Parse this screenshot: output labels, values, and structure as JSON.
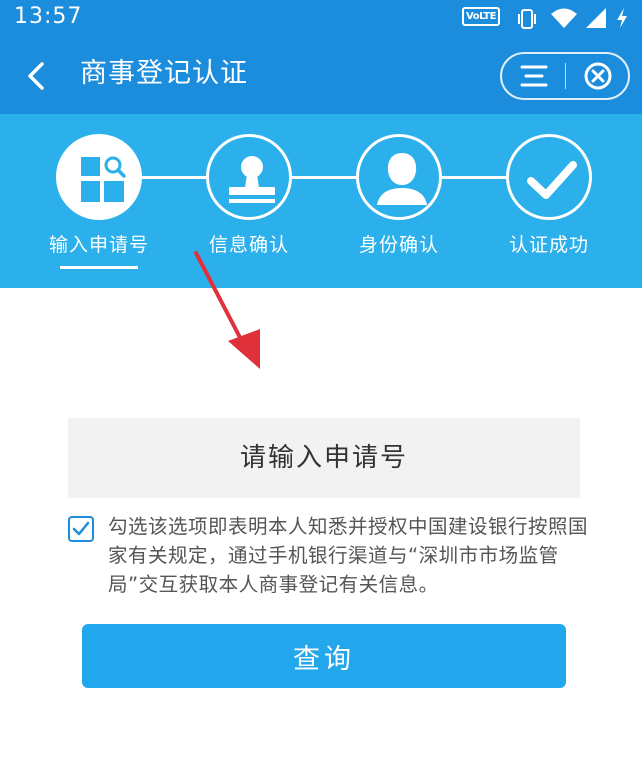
{
  "status_bar": {
    "time": "13:57",
    "network_badge": "VoLTE",
    "icons": [
      "vibrate-icon",
      "wifi-icon",
      "signal-icon",
      "charging-icon"
    ]
  },
  "nav": {
    "back_icon": "chevron-left-icon",
    "title": "商事登记认证",
    "capsule_icons": [
      "menu-icon",
      "close-circle-icon"
    ]
  },
  "steps": [
    {
      "label": "输入申请号",
      "icon": "search-grid-icon",
      "active": true
    },
    {
      "label": "信息确认",
      "icon": "stamp-icon",
      "active": false
    },
    {
      "label": "身份确认",
      "icon": "person-icon",
      "active": false
    },
    {
      "label": "认证成功",
      "icon": "checkmark-icon",
      "active": false
    }
  ],
  "form": {
    "application_no_placeholder": "请输入申请号",
    "agree_checked": true,
    "agree_text": "勾选该选项即表明本人知悉并授权中国建设银行按照国家有关规定，通过手机银行渠道与“深圳市市场监管局”交互获取本人商事登记有关信息。",
    "submit_label": "查询"
  },
  "colors": {
    "nav_bg": "#1c8cdc",
    "steps_bg": "#2bb0ec",
    "button_bg": "#23a7ec",
    "input_bg": "#f2f2f2",
    "annotation_arrow": "#e0303a"
  }
}
